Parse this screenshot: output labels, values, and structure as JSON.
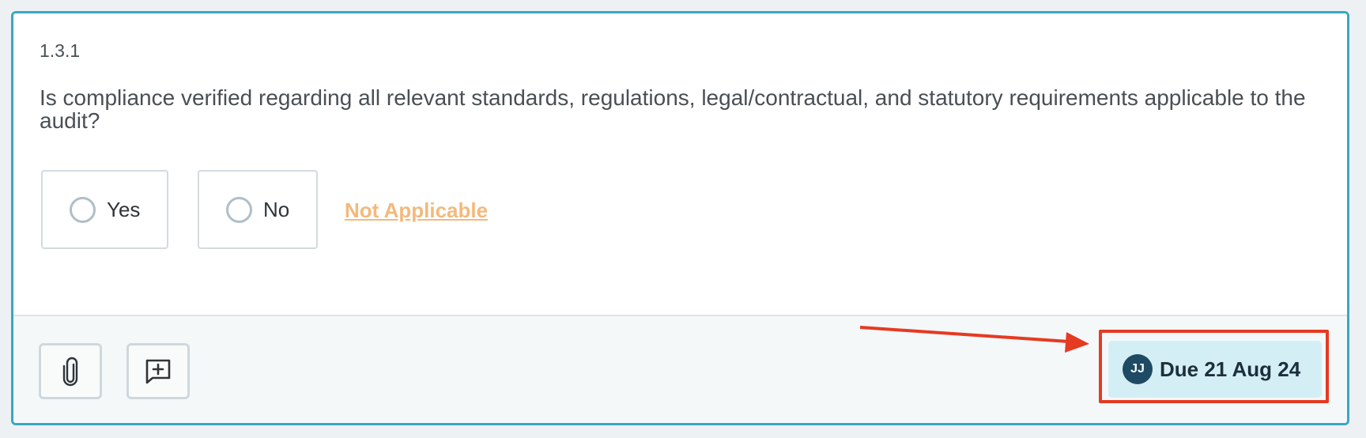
{
  "question": {
    "number": "1.3.1",
    "text": "Is compliance verified regarding all relevant standards, regulations, legal/contractual, and statutory requirements applicable to the audit?"
  },
  "options": {
    "yes_label": "Yes",
    "no_label": "No",
    "na_label": "Not Applicable"
  },
  "footer": {
    "attach_icon": "paperclip-icon",
    "comment_icon": "add-comment-icon",
    "assignee_initials": "JJ",
    "due_label": "Due 21 Aug 24"
  },
  "colors": {
    "card_border": "#3aa7c2",
    "na_link": "#f3b97c",
    "badge_bg": "#d4eef5",
    "avatar_bg": "#1e4a64",
    "annotation": "#e63a22"
  }
}
